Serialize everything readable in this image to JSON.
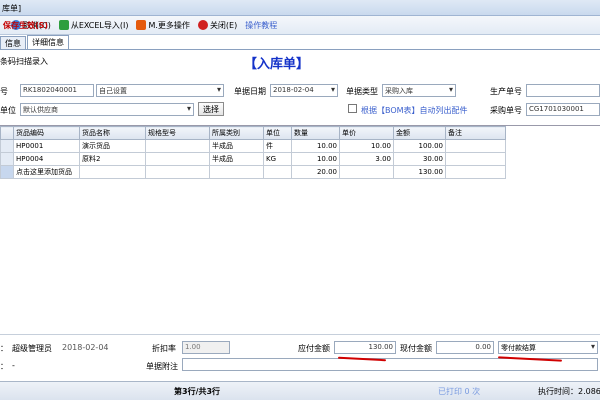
{
  "window": {
    "title": "库单]"
  },
  "toolbar": {
    "save": "保存生效(S)",
    "cancel": "取消(C)",
    "import": "从EXCEL导入(I)",
    "more": "M.更多操作",
    "close": "关闭(E)",
    "tutorial": "操作教程"
  },
  "tabs": [
    "信息",
    "详细信息"
  ],
  "form": {
    "barcode": "条码扫描录入",
    "title": "【入库单】",
    "doc_no_label": "号",
    "doc_no": "RK1802040001",
    "warehouse": "自己设置",
    "date_label": "单据日期",
    "date": "2018-02-04",
    "doc_type_label": "单据类型",
    "doc_type": "采购入库",
    "prod_no_label": "生产单号",
    "prod_no": "",
    "unit_label": "单位",
    "supplier": "默认供应商",
    "select_btn": "选择",
    "bom_text_1": "根据",
    "bom_text_2": "【BOM表】",
    "bom_text_3": "自动列出配件",
    "purchase_no_label": "采购单号",
    "purchase_no": "CG1701030001"
  },
  "table": {
    "headers": [
      "货品编码",
      "货品名称",
      "规格型号",
      "所属类别",
      "单位",
      "数量",
      "单价",
      "金额",
      "备注"
    ],
    "rows": [
      [
        "HP0001",
        "演示货品",
        "",
        "半成品",
        "件",
        "10.00",
        "10.00",
        "100.00",
        ""
      ],
      [
        "HP0004",
        "原料2",
        "",
        "半成品",
        "KG",
        "10.00",
        "3.00",
        "30.00",
        ""
      ],
      [
        "点击这里添加货品",
        "",
        "",
        "",
        "",
        "20.00",
        "",
        "130.00",
        ""
      ]
    ]
  },
  "footer": {
    "operator_label": "：",
    "operator": "超级管理员",
    "op_date": "2018-02-04",
    "discount_label": "折扣率",
    "discount": "1.00",
    "payable_label": "应付金额",
    "payable": "130.00",
    "cash_label": "现付金额",
    "cash": "0.00",
    "settle": "零付款结算",
    "remark_label": "单据附注",
    "colon2": "：",
    "dash": "-"
  },
  "status": {
    "rows": "第3行/共3行",
    "printed": "已打印 0 次",
    "exec": "执行时间：2.086"
  },
  "colors": {
    "accent": "#1533c9",
    "save": "#c40000",
    "underline": "#d10000"
  }
}
